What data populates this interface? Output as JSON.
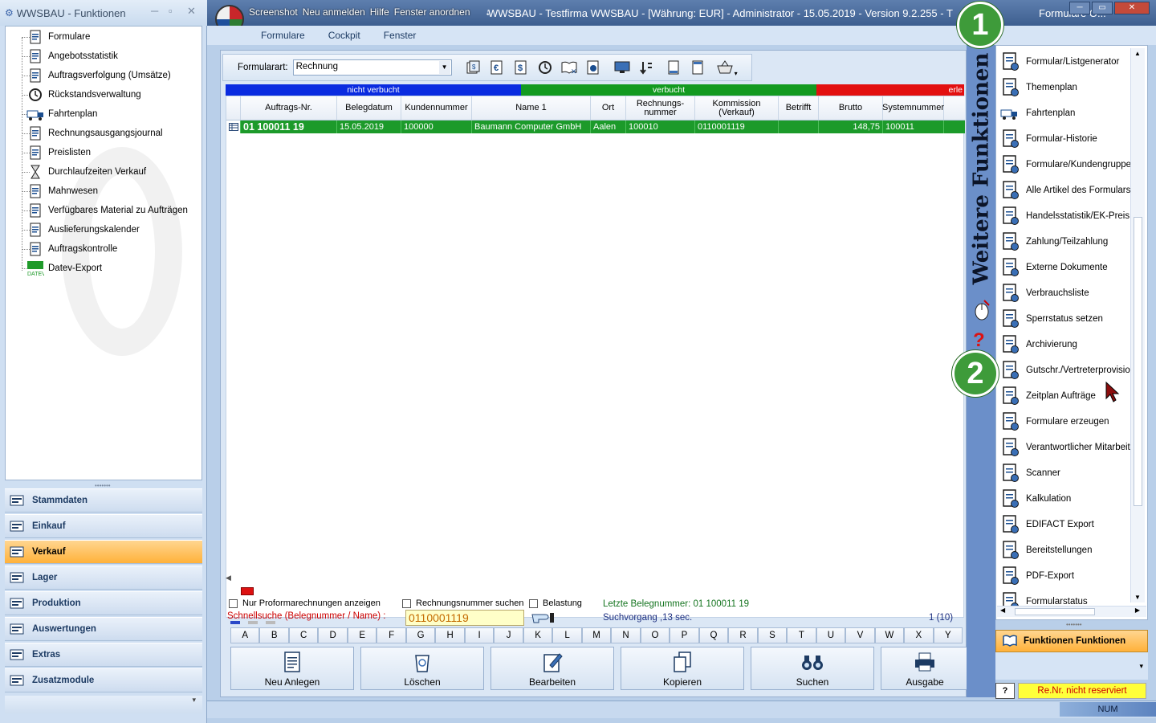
{
  "left_window": {
    "title": "WWSBAU - Funktionen",
    "tree": [
      {
        "label": "Formulare",
        "icon": "document-icon"
      },
      {
        "label": "Angebotsstatistik",
        "icon": "calendar-grid-icon"
      },
      {
        "label": "Auftragsverfolgung (Umsätze)",
        "icon": "tracking-icon"
      },
      {
        "label": "Rückstandsverwaltung",
        "icon": "history-icon"
      },
      {
        "label": "Fahrtenplan",
        "icon": "truck-icon"
      },
      {
        "label": "Rechnungsausgangsjournal",
        "icon": "journal-icon"
      },
      {
        "label": "Preislisten",
        "icon": "price-tag-icon"
      },
      {
        "label": "Durchlaufzeiten Verkauf",
        "icon": "hourglass-icon"
      },
      {
        "label": "Mahnwesen",
        "icon": "paragraph-icon"
      },
      {
        "label": "Verfügbares Material zu Aufträgen",
        "icon": "material-icon"
      },
      {
        "label": "Auslieferungskalender",
        "icon": "calendar-12-icon"
      },
      {
        "label": "Auftragskontrolle",
        "icon": "clipboard-check-icon"
      },
      {
        "label": "Datev-Export",
        "icon": "datev-icon"
      }
    ],
    "datev_logo_text": "DATEV",
    "nav": [
      {
        "label": "Stammdaten",
        "icon": "master-data-icon",
        "active": false
      },
      {
        "label": "Einkauf",
        "icon": "cart-icon",
        "active": false
      },
      {
        "label": "Verkauf",
        "icon": "cash-register-icon",
        "active": true
      },
      {
        "label": "Lager",
        "icon": "warehouse-icon",
        "active": false
      },
      {
        "label": "Produktion",
        "icon": "production-icon",
        "active": false
      },
      {
        "label": "Auswertungen",
        "icon": "analysis-icon",
        "active": false
      },
      {
        "label": "Extras",
        "icon": "extras-icon",
        "active": false
      },
      {
        "label": "Zusatzmodule",
        "icon": "modules-icon",
        "active": false
      }
    ]
  },
  "main_window": {
    "menu": [
      "Screenshot",
      "Neu anmelden",
      "Hilfe",
      "Fenster anordnen"
    ],
    "title_text": "WWSBAU - Testfirma WWSBAU - [Währung: EUR] - Administrator - 15.05.2019 - Version 9.2.255 - T",
    "title_tail": "Formulare O...",
    "submenu": [
      "Formulare",
      "Cockpit",
      "Fenster"
    ],
    "toolbar": {
      "formart_label": "Formularart:",
      "formart_value": "Rechnung"
    },
    "status_segments": [
      {
        "label": "nicht verbucht",
        "color": "#0a2be0"
      },
      {
        "label": "verbucht",
        "color": "#139a20"
      },
      {
        "label": "erle",
        "color": "#e31010"
      }
    ],
    "columns": [
      "Auftrags-Nr.",
      "Belegdatum",
      "Kundennummer",
      "Name 1",
      "Ort",
      "Rechnungs-\nnummer",
      "Kommission (Verkauf)",
      "Betrifft",
      "Brutto",
      "Systemnummer"
    ],
    "rows": [
      [
        "01 100011 19",
        "15.05.2019",
        "100000",
        "Baumann Computer GmbH",
        "Aalen",
        "100010",
        "0110001119",
        "",
        "148,75",
        "100011"
      ]
    ],
    "filters": {
      "proforma": "Nur Proformarechnungen anzeigen",
      "rechnungsnr": "Rechnungsnummer suchen",
      "belastung": "Belastung"
    },
    "schnellsuche_label": "Schnellsuche (Belegnummer / Name) :",
    "schnellsuche_value": "0110001119",
    "letzte_belegnummer": "Letzte Belegnummer: 01 100011 19",
    "suchvorgang": "Suchvorgang ,13 sec.",
    "count": "1  (10)",
    "alphabet": [
      "A",
      "B",
      "C",
      "D",
      "E",
      "F",
      "G",
      "H",
      "I",
      "J",
      "K",
      "L",
      "M",
      "N",
      "O",
      "P",
      "Q",
      "R",
      "S",
      "T",
      "U",
      "V",
      "W",
      "X",
      "Y"
    ],
    "buttons": [
      {
        "label": "Neu Anlegen",
        "icon": "new-document-icon"
      },
      {
        "label": "Löschen",
        "icon": "trash-icon"
      },
      {
        "label": "Bearbeiten",
        "icon": "edit-icon"
      },
      {
        "label": "Kopieren",
        "icon": "copy-icon"
      },
      {
        "label": "Suchen",
        "icon": "binoculars-icon"
      },
      {
        "label": "Ausgabe",
        "icon": "printer-icon"
      }
    ],
    "status_num": "NUM"
  },
  "right_panel": {
    "vertical_title": "Weitere Funktionen",
    "items": [
      {
        "label": "Formular/Listgenerator",
        "icon": "list-generator-icon"
      },
      {
        "label": "Themenplan",
        "icon": "topic-plan-icon"
      },
      {
        "label": "Fahrtenplan",
        "icon": "truck-icon"
      },
      {
        "label": "Formular-Historie",
        "icon": "form-history-icon"
      },
      {
        "label": "Formulare/Kundengruppen",
        "icon": "customer-groups-icon"
      },
      {
        "label": "Alle Artikel des Formulars",
        "icon": "articles-icon"
      },
      {
        "label": "Handelsstatistik/EK-Preis",
        "icon": "statistics-icon"
      },
      {
        "label": "Zahlung/Teilzahlung",
        "icon": "payment-icon"
      },
      {
        "label": "Externe Dokumente",
        "icon": "external-doc-icon"
      },
      {
        "label": "Verbrauchsliste",
        "icon": "consumption-icon"
      },
      {
        "label": "Sperrstatus setzen",
        "icon": "key-lock-icon"
      },
      {
        "label": "Archivierung",
        "icon": "archive-icon"
      },
      {
        "label": "Gutschr./Vertreterprovision",
        "icon": "commission-icon"
      },
      {
        "label": "Zeitplan Aufträge",
        "icon": "schedule-icon"
      },
      {
        "label": "Formulare erzeugen",
        "icon": "create-forms-icon"
      },
      {
        "label": "Verantwortlicher Mitarbeiter",
        "icon": "employee-icon"
      },
      {
        "label": "Scanner",
        "icon": "scanner-icon"
      },
      {
        "label": "Kalkulation",
        "icon": "calculator-icon"
      },
      {
        "label": "EDIFACT Export",
        "icon": "edifact-icon"
      },
      {
        "label": "Bereitstellungen",
        "icon": "provision-icon"
      },
      {
        "label": "PDF-Export",
        "icon": "pdf-export-icon"
      },
      {
        "label": "Formularstatus",
        "icon": "form-status-icon"
      }
    ],
    "funktionen_button": "Funktionen Funktionen",
    "help_button": "?",
    "renr_status": "Re.Nr. nicht reserviert"
  },
  "annotations": [
    "1",
    "2"
  ]
}
